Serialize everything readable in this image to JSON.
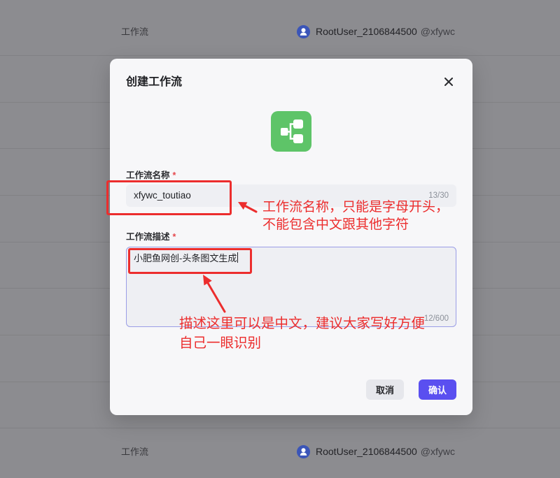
{
  "background_list": {
    "rows": [
      {
        "type": "工作流",
        "user": "RootUser_2106844500",
        "handle": "@xfywc",
        "avatar_icon": "user-icon"
      },
      {
        "type": "工作流",
        "user": "RootUser_2106844500",
        "handle": "@xfywc",
        "avatar_icon": "user-icon"
      }
    ]
  },
  "modal": {
    "title": "创建工作流",
    "close_icon": "close-icon",
    "app_icon": "workflow-icon",
    "name_field": {
      "label": "工作流名称",
      "required_mark": "*",
      "value": "xfywc_toutiao",
      "counter": "13/30"
    },
    "description_field": {
      "label": "工作流描述",
      "required_mark": "*",
      "value": "小肥鱼网创-头条图文生成",
      "counter": "12/600"
    },
    "cancel_label": "取消",
    "confirm_label": "确认"
  },
  "annotations": {
    "name_note": [
      "工作流名称，只能是字母开头，",
      "不能包含中文跟其他字符"
    ],
    "description_note": [
      "描述这里可以是中文，建议大家写好方便",
      "自己一眼识别"
    ]
  },
  "colors": {
    "accent": "#5a4ff0",
    "app_icon_bg": "#5ec468",
    "annotation_red": "#ec2d2d",
    "required_mark": "#e5484d",
    "avatar_bg": "#3b55b8",
    "overlay_bg": "#8c8c90"
  }
}
